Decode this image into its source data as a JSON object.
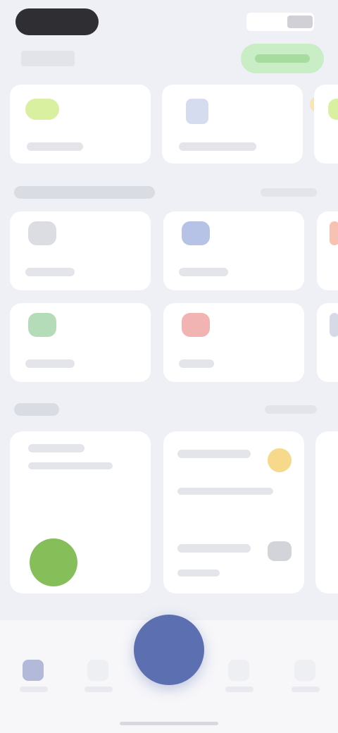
{
  "theme": {
    "background": "#eef0f5",
    "card": "#ffffff",
    "accent_blue": "#5c6fb0",
    "accent_green": "#86bf5a",
    "accent_yellow": "#f7d98c",
    "accent_red": "#f2b3b3",
    "quick_green": "#d9f0a0",
    "tile_blue": "#b7c3e6",
    "tile_green": "#b5dcb9",
    "tile_gray": "#dcdde3"
  },
  "icons": {
    "quick_1": "lime-pill-icon",
    "quick_2": "blue-doc-icon",
    "quick_3": "yellow-badge-icon",
    "tile_1": "gray-square-icon",
    "tile_2": "blue-square-icon",
    "tile_3": "green-square-icon",
    "tile_4": "red-square-icon",
    "fab": "plus-icon"
  }
}
